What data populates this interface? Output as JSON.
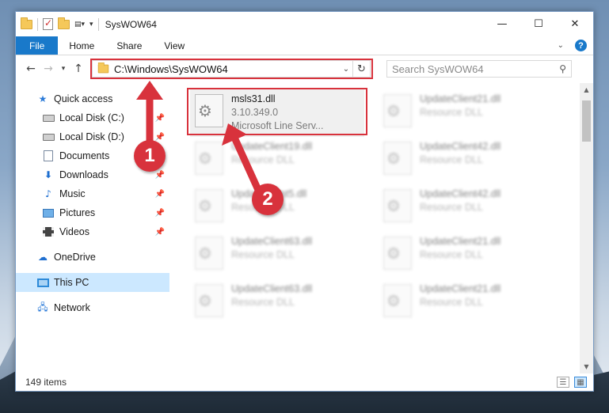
{
  "window": {
    "title": "SysWOW64",
    "controls": {
      "minimize": "—",
      "maximize": "☐",
      "close": "✕"
    }
  },
  "ribbon": {
    "tabs": [
      "File",
      "Home",
      "Share",
      "View"
    ],
    "expand_icon": "chevron-down-icon",
    "help_label": "?"
  },
  "navigation": {
    "back_icon": "back-arrow-icon",
    "forward_icon": "forward-arrow-icon",
    "recent_icon": "chevron-down-icon",
    "up_icon": "up-arrow-icon",
    "address": "C:\\Windows\\SysWOW64",
    "search_placeholder": "Search SysWOW64"
  },
  "sidebar": {
    "quick_access": "Quick access",
    "items": [
      {
        "label": "Local Disk (C:)",
        "icon": "disk-icon",
        "pinned": true
      },
      {
        "label": "Local Disk (D:)",
        "icon": "disk-icon",
        "pinned": true
      },
      {
        "label": "Documents",
        "icon": "documents-icon",
        "pinned": true
      },
      {
        "label": "Downloads",
        "icon": "downloads-icon",
        "pinned": true
      },
      {
        "label": "Music",
        "icon": "music-icon",
        "pinned": true
      },
      {
        "label": "Pictures",
        "icon": "pictures-icon",
        "pinned": true
      },
      {
        "label": "Videos",
        "icon": "videos-icon",
        "pinned": true
      }
    ],
    "onedrive": "OneDrive",
    "this_pc": "This PC",
    "network": "Network"
  },
  "files": {
    "highlighted": {
      "name": "msls31.dll",
      "version": "3.10.349.0",
      "description": "Microsoft Line Serv..."
    },
    "blurred": [
      {
        "name": "UpdateClient21.dll",
        "type": "Resource DLL"
      },
      {
        "name": "UpdateClient19.dll",
        "type": "Resource DLL"
      },
      {
        "name": "UpdateClient42.dll",
        "type": "Resource DLL"
      },
      {
        "name": "UpdateClient5.dll",
        "type": "Resource DLL"
      },
      {
        "name": "UpdateClient42.dll",
        "type": "Resource DLL"
      },
      {
        "name": "UpdateClient63.dll",
        "type": "Resource DLL"
      },
      {
        "name": "UpdateClient21.dll",
        "type": "Resource DLL"
      },
      {
        "name": "UpdateClient63.dll",
        "type": "Resource DLL"
      },
      {
        "name": "UpdateClient21.dll",
        "type": "Resource DLL"
      }
    ]
  },
  "status": {
    "item_count": "149 items"
  },
  "annotations": {
    "step1": "1",
    "step2": "2",
    "color": "#d8323c"
  },
  "colors": {
    "accent": "#1979ca",
    "selection": "#cce8ff",
    "highlight": "#d8323c"
  }
}
